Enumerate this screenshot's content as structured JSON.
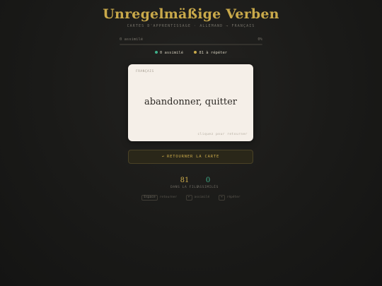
{
  "header": {
    "title": "Unregelmäßige Verben",
    "subtitle": "CARTES D'APPRENTISSAGE · ALLEMAND → FRANÇAIS"
  },
  "progress": {
    "label": "0 assimilé",
    "percent_text": "0%",
    "value": 0
  },
  "legend": {
    "learned": "0 assimilé",
    "review": "81 à répéter"
  },
  "card": {
    "language": "FRANÇAIS",
    "word": "abandonner, quitter",
    "hint": "cliquez pour retourner"
  },
  "flip_button": {
    "arrow": "↩",
    "label": "RETOURNER LA CARTE"
  },
  "stats": {
    "queue": {
      "value": "81",
      "label": "DANS LA FILE"
    },
    "learned": {
      "value": "0",
      "label": "ASSIMILÉS"
    }
  },
  "shortcuts": [
    {
      "key": "Espace",
      "label": "retourner"
    },
    {
      "key": "←",
      "label": "assimilé"
    },
    {
      "key": "→",
      "label": "répéter"
    }
  ],
  "colors": {
    "accent": "#c9a94a",
    "learned": "#3fb08a",
    "card": "#f5efe8",
    "background": "#1a1a18"
  }
}
